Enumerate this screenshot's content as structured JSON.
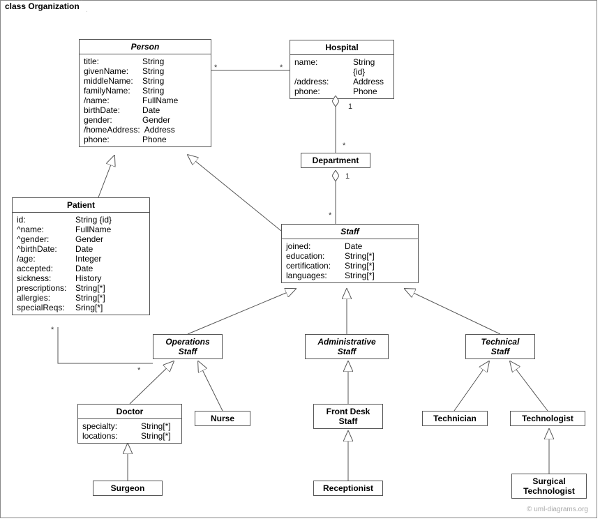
{
  "frame": {
    "title": "class Organization"
  },
  "classes": {
    "person": {
      "name": "Person",
      "attrs": [
        {
          "key": "title:",
          "type": "String"
        },
        {
          "key": "givenName:",
          "type": "String"
        },
        {
          "key": "middleName:",
          "type": "String"
        },
        {
          "key": "familyName:",
          "type": "String"
        },
        {
          "key": "/name:",
          "type": "FullName"
        },
        {
          "key": "birthDate:",
          "type": "Date"
        },
        {
          "key": "gender:",
          "type": "Gender"
        },
        {
          "key": "/homeAddress:",
          "type": "Address"
        },
        {
          "key": "phone:",
          "type": "Phone"
        }
      ]
    },
    "hospital": {
      "name": "Hospital",
      "attrs": [
        {
          "key": "name:",
          "type": "String {id}"
        },
        {
          "key": "/address:",
          "type": "Address"
        },
        {
          "key": "phone:",
          "type": "Phone"
        }
      ]
    },
    "department": {
      "name": "Department"
    },
    "patient": {
      "name": "Patient",
      "attrs": [
        {
          "key": "id:",
          "type": "String {id}"
        },
        {
          "key": "^name:",
          "type": "FullName"
        },
        {
          "key": "^gender:",
          "type": "Gender"
        },
        {
          "key": "^birthDate:",
          "type": "Date"
        },
        {
          "key": "/age:",
          "type": "Integer"
        },
        {
          "key": "accepted:",
          "type": "Date"
        },
        {
          "key": "sickness:",
          "type": "History"
        },
        {
          "key": "prescriptions:",
          "type": "String[*]"
        },
        {
          "key": "allergies:",
          "type": "String[*]"
        },
        {
          "key": "specialReqs:",
          "type": "Sring[*]"
        }
      ]
    },
    "staff": {
      "name": "Staff",
      "attrs": [
        {
          "key": "joined:",
          "type": "Date"
        },
        {
          "key": "education:",
          "type": "String[*]"
        },
        {
          "key": "certification:",
          "type": "String[*]"
        },
        {
          "key": "languages:",
          "type": "String[*]"
        }
      ]
    },
    "opsStaff": {
      "name": "Operations",
      "name2": "Staff"
    },
    "adminStaff": {
      "name": "Administrative",
      "name2": "Staff"
    },
    "techStaff": {
      "name": "Technical",
      "name2": "Staff"
    },
    "doctor": {
      "name": "Doctor",
      "attrs": [
        {
          "key": "specialty:",
          "type": "String[*]"
        },
        {
          "key": "locations:",
          "type": "String[*]"
        }
      ]
    },
    "nurse": {
      "name": "Nurse"
    },
    "frontDesk": {
      "name": "Front Desk",
      "name2": "Staff"
    },
    "technician": {
      "name": "Technician"
    },
    "technologist": {
      "name": "Technologist"
    },
    "surgeon": {
      "name": "Surgeon"
    },
    "receptionist": {
      "name": "Receptionist"
    },
    "surgTech": {
      "name": "Surgical",
      "name2": "Technologist"
    }
  },
  "mult": {
    "ph_star_left": "*",
    "ph_star_right": "*",
    "hd_one": "1",
    "hd_star": "*",
    "ds_one": "1",
    "ds_star": "*",
    "po_star_top": "*",
    "po_star_bot": "*"
  },
  "watermark": "© uml-diagrams.org"
}
